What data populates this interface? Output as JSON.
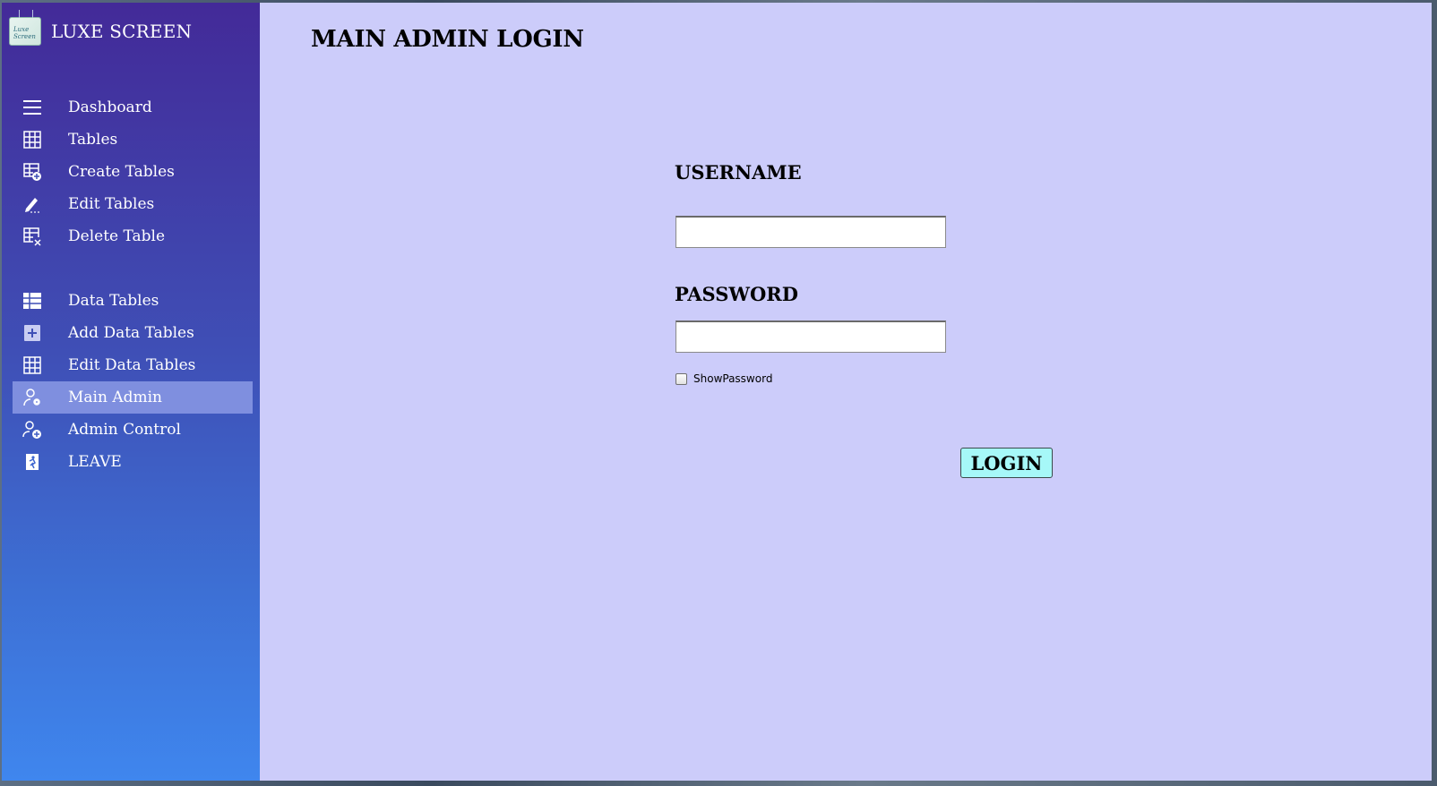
{
  "app": {
    "brand_title": "LUXE SCREEN",
    "logo_text": "Luxe Screen"
  },
  "sidebar": {
    "group1": [
      {
        "label": "Dashboard",
        "icon": "menu-icon"
      },
      {
        "label": "Tables",
        "icon": "grid-icon"
      },
      {
        "label": "Create Tables",
        "icon": "table-add-icon"
      },
      {
        "label": "Edit Tables",
        "icon": "pencil-icon"
      },
      {
        "label": "Delete Table",
        "icon": "table-delete-icon"
      }
    ],
    "group2": [
      {
        "label": "Data Tables",
        "icon": "table-solid-icon"
      },
      {
        "label": "Add Data Tables",
        "icon": "plus-square-icon"
      },
      {
        "label": "Edit Data Tables",
        "icon": "grid-icon"
      },
      {
        "label": "Main Admin",
        "icon": "admin-settings-icon",
        "active": true
      },
      {
        "label": "Admin Control",
        "icon": "user-add-icon"
      },
      {
        "label": "LEAVE",
        "icon": "exit-icon"
      }
    ],
    "active_color": "#7f8fdf"
  },
  "main": {
    "title": "MAIN ADMIN LOGIN",
    "username_label": "USERNAME",
    "username_value": "",
    "password_label": "PASSWORD",
    "password_value": "",
    "show_password_label": "ShowPassword",
    "show_password_checked": false,
    "login_label": "LOGIN",
    "login_color": "#a6f8f8",
    "background_color": "#ccccfa"
  }
}
